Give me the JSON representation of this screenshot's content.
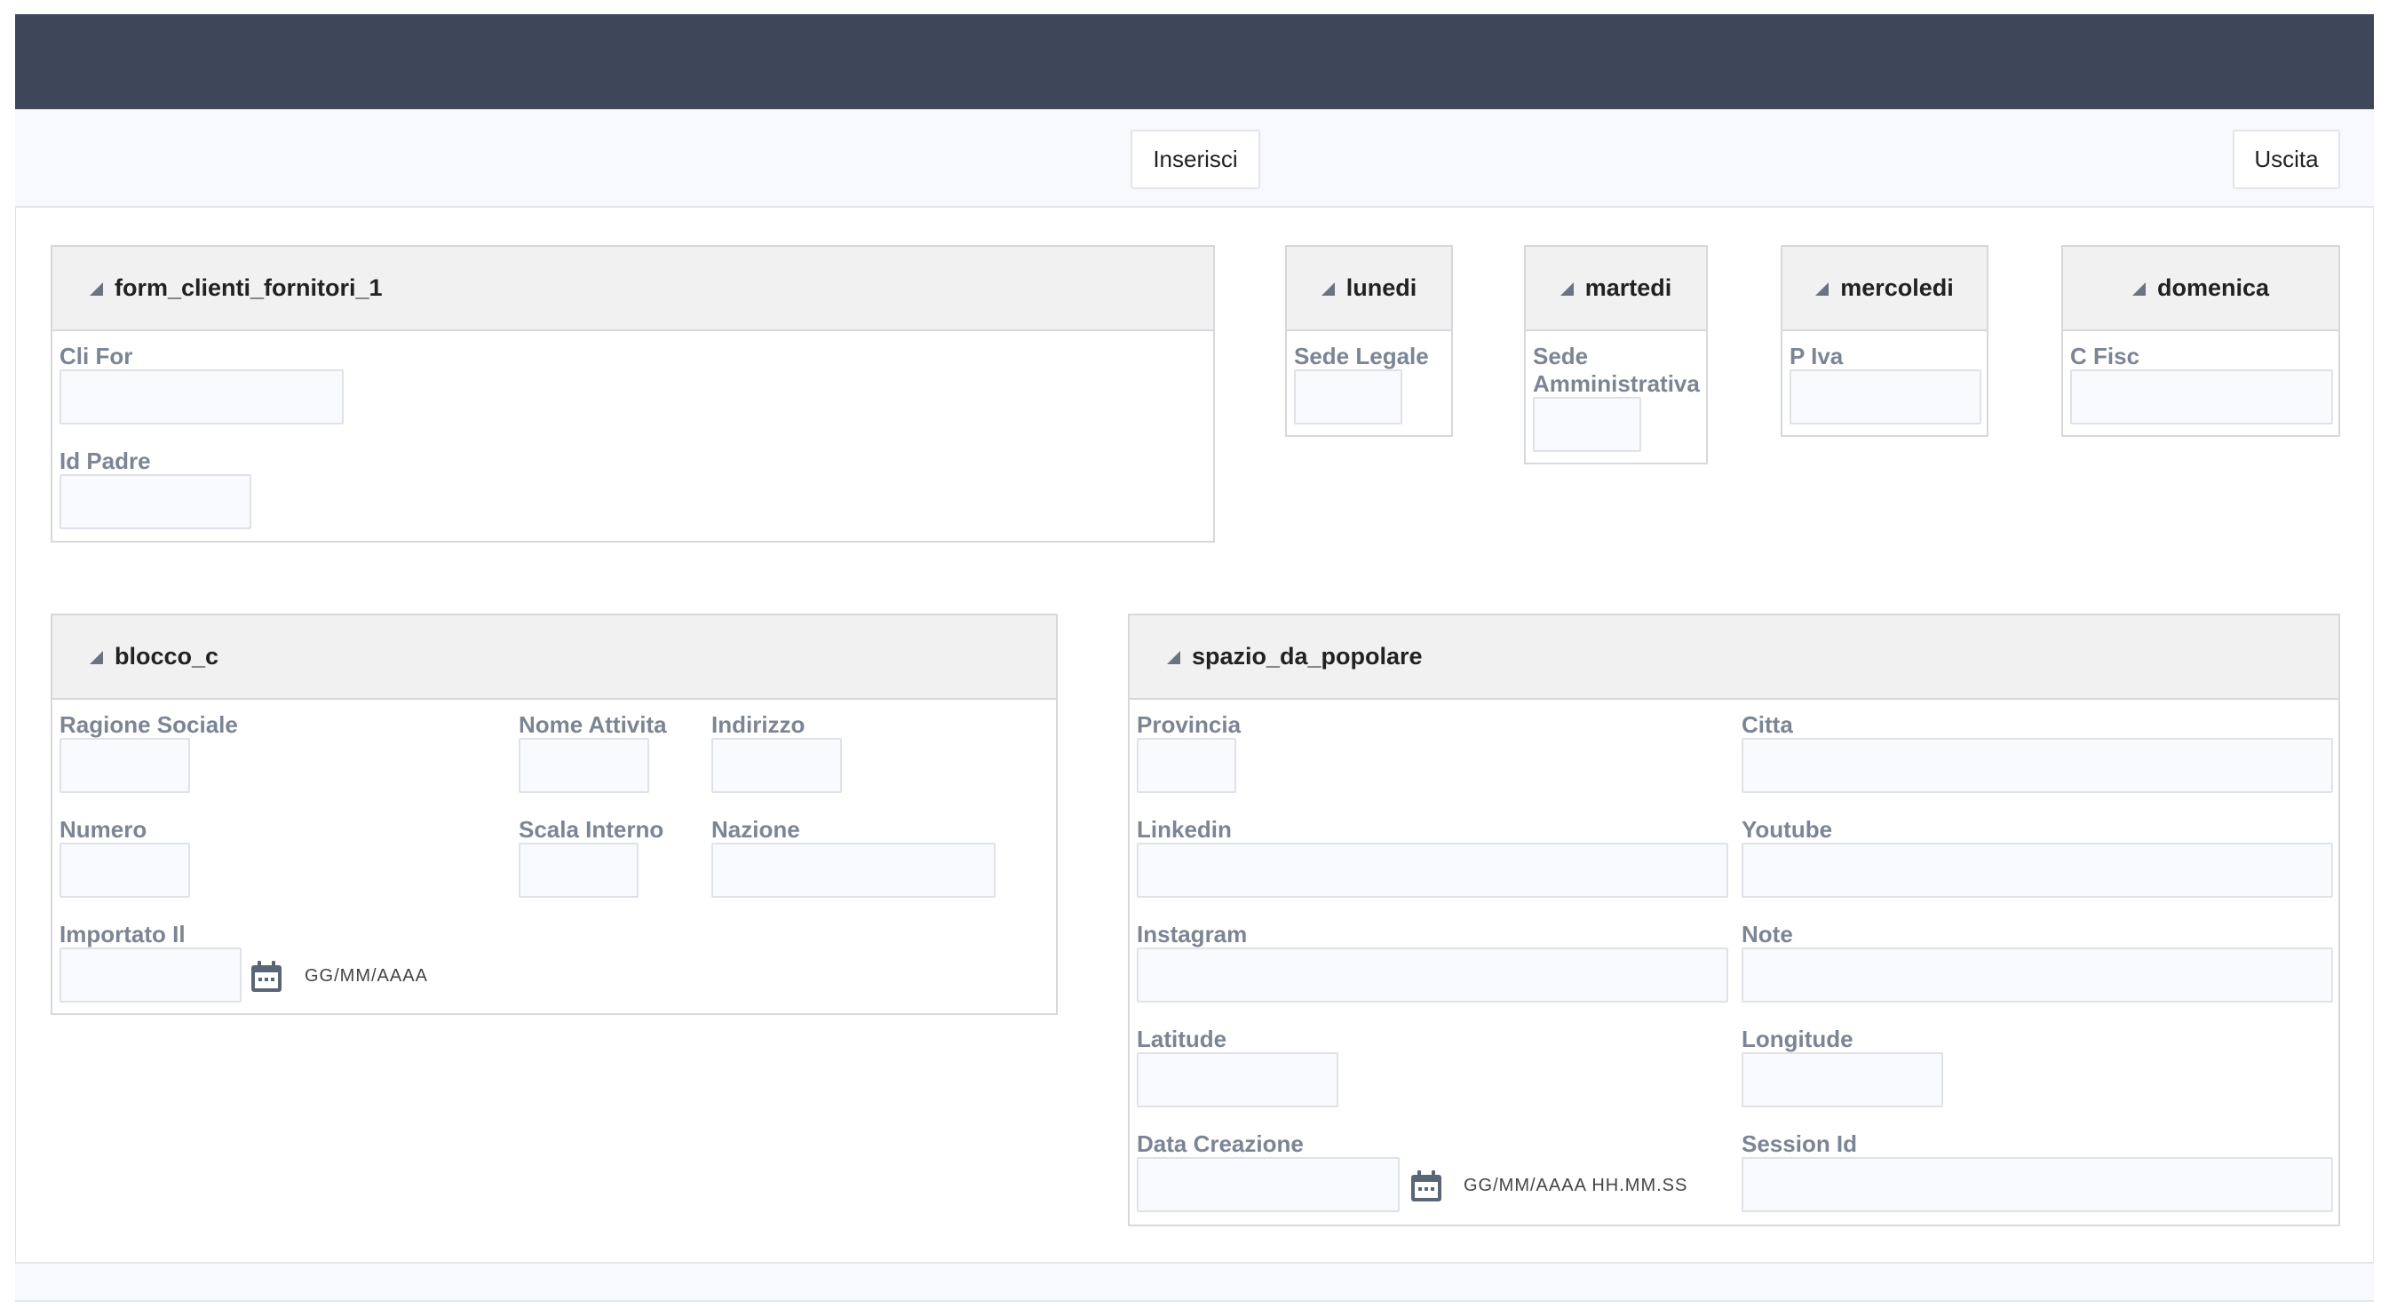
{
  "toolbar": {
    "insert_label": "Inserisci",
    "exit_label": "Uscita"
  },
  "panels": {
    "form": {
      "title": "form_clienti_fornitori_1",
      "fields": {
        "cli_for": "Cli For",
        "id_padre": "Id Padre"
      }
    },
    "lunedi": {
      "title": "lunedi",
      "field": "Sede Legale"
    },
    "martedi": {
      "title": "martedi",
      "field": "Sede Amministrativa"
    },
    "mercoledi": {
      "title": "mercoledi",
      "field": "P Iva"
    },
    "domenica": {
      "title": "domenica",
      "field": "C Fisc"
    },
    "blocco_c": {
      "title": "blocco_c",
      "fields": {
        "ragione_sociale": "Ragione Sociale",
        "nome_attivita": "Nome Attivita",
        "indirizzo": "Indirizzo",
        "numero": "Numero",
        "scala_interno": "Scala Interno",
        "nazione": "Nazione",
        "importato_il": "Importato Il"
      },
      "date_hint": "GG/MM/AAAA"
    },
    "spazio": {
      "title": "spazio_da_popolare",
      "fields": {
        "provincia": "Provincia",
        "citta": "Citta",
        "linkedin": "Linkedin",
        "youtube": "Youtube",
        "instagram": "Instagram",
        "note": "Note",
        "latitude": "Latitude",
        "longitude": "Longitude",
        "data_creazione": "Data Creazione",
        "session_id": "Session Id"
      },
      "datetime_hint": "GG/MM/AAAA HH.MM.SS"
    }
  },
  "icons": {
    "collapse": "collapse-triangle-icon",
    "calendar": "calendar-icon"
  },
  "colors": {
    "header_bar": "#3d4759",
    "label": "#7c8594",
    "panel_header": "#f1f1f1"
  }
}
